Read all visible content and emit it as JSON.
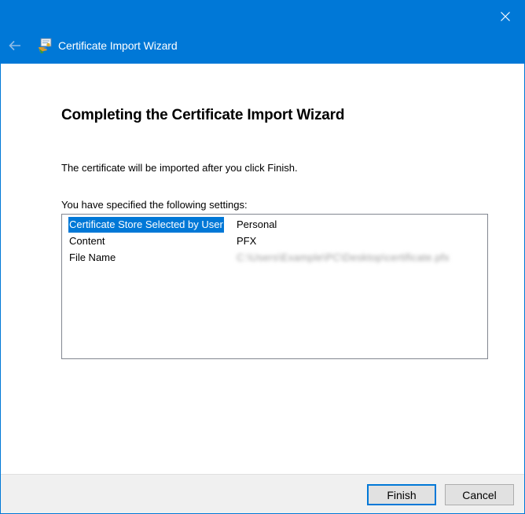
{
  "window": {
    "title": "Certificate Import Wizard",
    "accent_color": "#0078d7",
    "icons": {
      "close": "close-icon",
      "back": "back-arrow-icon",
      "app": "certificate-icon"
    }
  },
  "page": {
    "heading": "Completing the Certificate Import Wizard",
    "info": "The certificate will be imported after you click Finish.",
    "settings_label": "You have specified the following settings:"
  },
  "settings": {
    "rows": [
      {
        "key": "Certificate Store Selected by User",
        "value": "Personal",
        "selected": true
      },
      {
        "key": "Content",
        "value": "PFX",
        "selected": false
      },
      {
        "key": "File Name",
        "value": "C:\\Users\\Example\\PC\\Desktop\\certificate.pfx",
        "selected": false,
        "blurred": true
      }
    ]
  },
  "footer": {
    "finish_label": "Finish",
    "cancel_label": "Cancel"
  }
}
